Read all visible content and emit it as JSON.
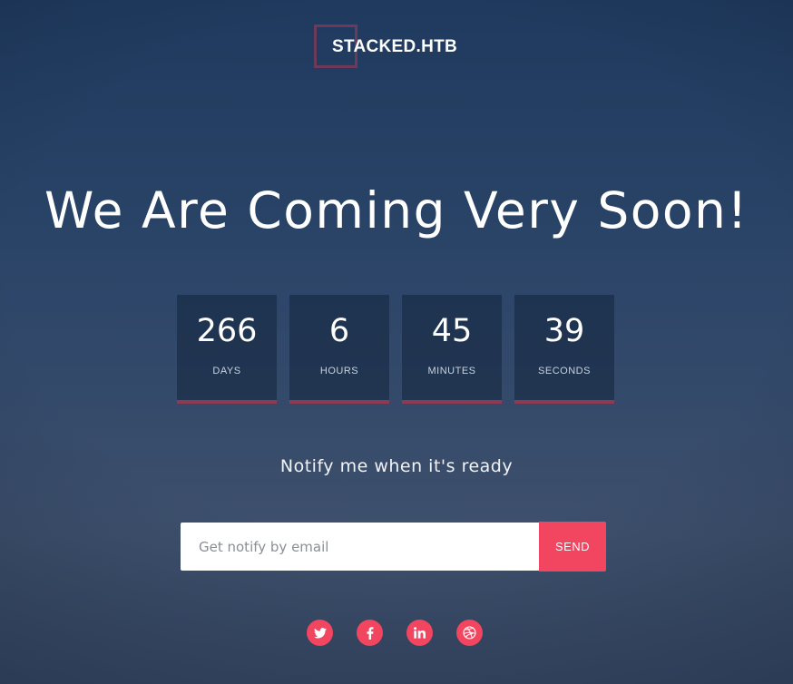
{
  "brand": {
    "name": "STACKED.HTB"
  },
  "headline": "We Are Coming Very Soon!",
  "countdown": [
    {
      "value": "266",
      "label": "DAYS"
    },
    {
      "value": "6",
      "label": "HOURS"
    },
    {
      "value": "45",
      "label": "MINUTES"
    },
    {
      "value": "39",
      "label": "SECONDS"
    }
  ],
  "notify": {
    "text": "Notify me when it's ready",
    "email_value": "",
    "email_placeholder": "Get notify by email",
    "send_label": "SEND"
  },
  "social": [
    {
      "icon": "twitter-icon"
    },
    {
      "icon": "facebook-icon"
    },
    {
      "icon": "linkedin-icon"
    },
    {
      "icon": "dribbble-icon"
    }
  ],
  "colors": {
    "accent": "#f2455f",
    "countdown_underline": "#8e3a52",
    "logo_frame": "#6e3a5a"
  }
}
